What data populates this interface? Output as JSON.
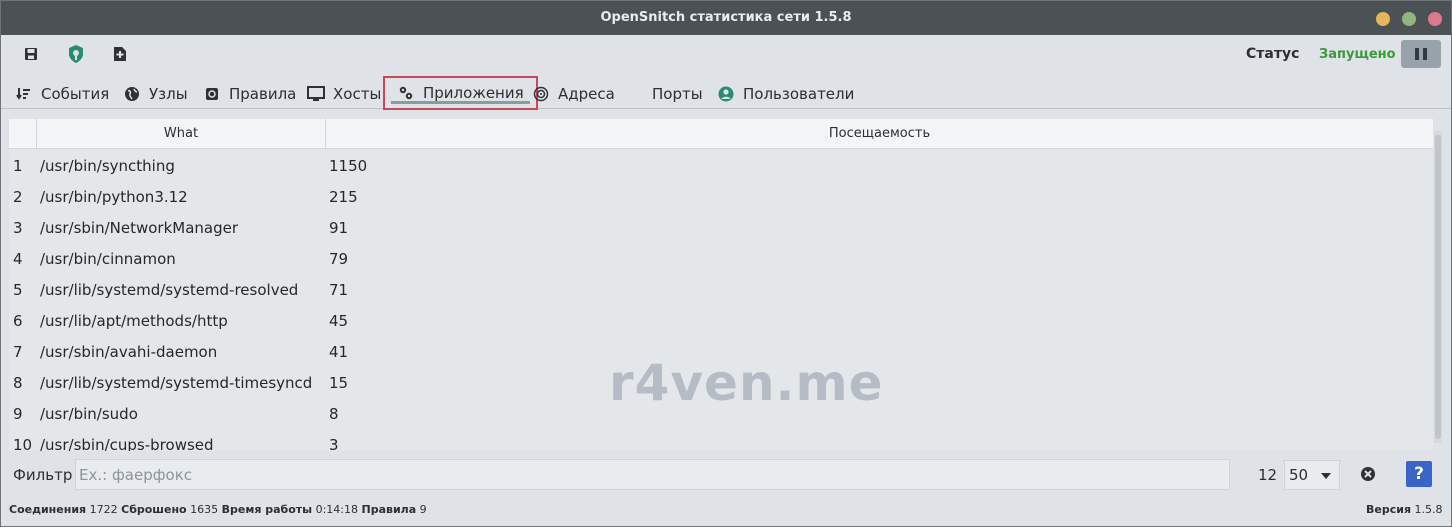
{
  "window": {
    "title": "OpenSnitch статистика сети 1.5.8"
  },
  "toolbar": {
    "save_icon": "floppy-disk-icon",
    "firewall_icon": "firewall-icon",
    "new_rule_icon": "add-file-icon",
    "status_label": "Статус",
    "status_value": "Запущено",
    "status_color": "#3a9a3a",
    "pause_icon": "pause-icon"
  },
  "tabs": [
    {
      "label": "События",
      "icon": "events-icon"
    },
    {
      "label": "Узлы",
      "icon": "globe-icon"
    },
    {
      "label": "Правила",
      "icon": "rules-icon"
    },
    {
      "label": "Хосты",
      "icon": "monitor-icon"
    },
    {
      "label": "Приложения",
      "icon": "gears-icon",
      "active": true
    },
    {
      "label": "Адреса",
      "icon": "network-icon"
    },
    {
      "label": "Порты",
      "icon": ""
    },
    {
      "label": "Пользователи",
      "icon": "user-icon"
    }
  ],
  "table": {
    "columns": [
      "What",
      "Посещаемость"
    ],
    "rows": [
      {
        "n": "1",
        "what": "/usr/bin/syncthing",
        "hits": "1150"
      },
      {
        "n": "2",
        "what": "/usr/bin/python3.12",
        "hits": "215"
      },
      {
        "n": "3",
        "what": "/usr/sbin/NetworkManager",
        "hits": "91"
      },
      {
        "n": "4",
        "what": "/usr/bin/cinnamon",
        "hits": "79"
      },
      {
        "n": "5",
        "what": "/usr/lib/systemd/systemd-resolved",
        "hits": "71"
      },
      {
        "n": "6",
        "what": "/usr/lib/apt/methods/http",
        "hits": "45"
      },
      {
        "n": "7",
        "what": "/usr/sbin/avahi-daemon",
        "hits": "41"
      },
      {
        "n": "8",
        "what": "/usr/lib/systemd/systemd-timesyncd",
        "hits": "15"
      },
      {
        "n": "9",
        "what": "/usr/bin/sudo",
        "hits": "8"
      },
      {
        "n": "10",
        "what": "/usr/sbin/cups-browsed",
        "hits": "3"
      }
    ]
  },
  "watermark": "r4ven.me",
  "filter": {
    "label": "Фильтр",
    "placeholder": "Ex.: фаерфокс",
    "count": "12",
    "per_page": "50"
  },
  "statusbar": {
    "connections_label": "Соединения",
    "connections_value": "1722",
    "dropped_label": "Сброшено",
    "dropped_value": "1635",
    "uptime_label": "Время работы",
    "uptime_value": "0:14:18",
    "rules_label": "Правила",
    "rules_value": "9",
    "version_label": "Версия",
    "version_value": "1.5.8"
  }
}
